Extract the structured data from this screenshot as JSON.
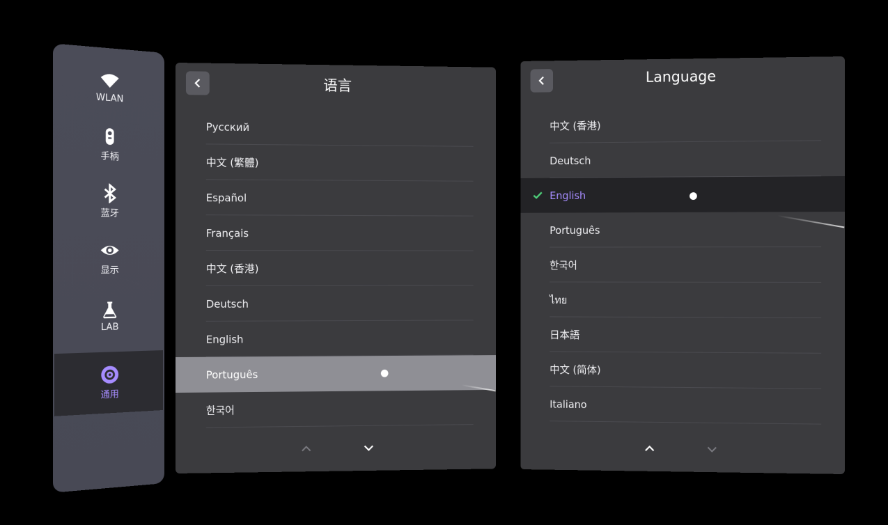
{
  "sidebar": {
    "items": [
      {
        "label": "WLAN",
        "icon": "wifi-icon"
      },
      {
        "label": "手柄",
        "icon": "controller-icon"
      },
      {
        "label": "蓝牙",
        "icon": "bluetooth-icon"
      },
      {
        "label": "显示",
        "icon": "eye-icon"
      },
      {
        "label": "LAB",
        "icon": "flask-icon"
      },
      {
        "label": "通用",
        "icon": "gear-icon"
      }
    ],
    "active_index": 5,
    "accent_color": "#a68cff"
  },
  "left_language_panel": {
    "title": "语言",
    "items": [
      "Русский",
      "中文 (繁體)",
      "Español",
      "Français",
      "中文 (香港)",
      "Deutsch",
      "English",
      "Português",
      "한국어"
    ],
    "highlighted": "Português"
  },
  "right_language_panel": {
    "title": "Language",
    "items": [
      "中文 (香港)",
      "Deutsch",
      "English",
      "Português",
      "한국어",
      "ไทย",
      "日本語",
      "中文 (简体)",
      "Italiano"
    ],
    "selected": "English",
    "check_color": "#4ed07a"
  }
}
